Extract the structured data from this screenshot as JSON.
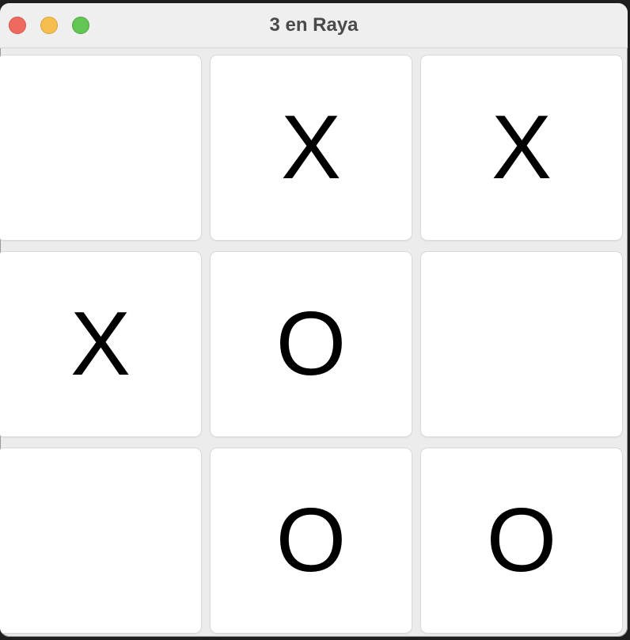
{
  "window": {
    "title": "3 en Raya",
    "controls": [
      "close",
      "minimize",
      "zoom"
    ]
  },
  "colors": {
    "close": "#ee6a5f",
    "minimize": "#f5be4f",
    "zoom": "#62c554",
    "cell_background": "#ffffff",
    "board_background": "#ececec",
    "mark": "#000000"
  },
  "board": {
    "cells": [
      {
        "value": ""
      },
      {
        "value": "X"
      },
      {
        "value": "X"
      },
      {
        "value": "X"
      },
      {
        "value": "O"
      },
      {
        "value": ""
      },
      {
        "value": ""
      },
      {
        "value": "O"
      },
      {
        "value": "O"
      }
    ]
  }
}
